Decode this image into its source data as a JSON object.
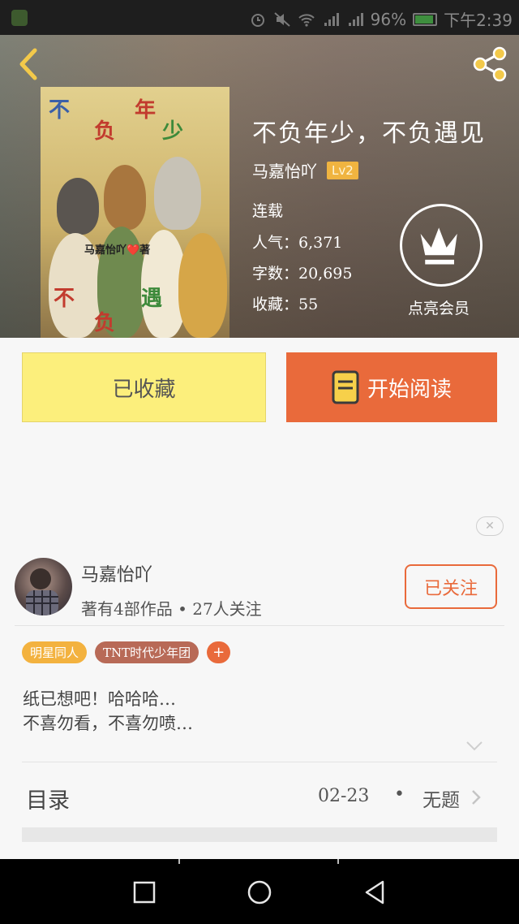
{
  "status_bar": {
    "battery": "96%",
    "time": "下午2:39"
  },
  "header": {
    "back_icon": "chevron-left-icon",
    "share_icon": "share-icon"
  },
  "book": {
    "title": "不负年少，不负遇见",
    "author": "马嘉怡吖",
    "level": "Lv2",
    "status": "连载",
    "popularity": "人气：6,371",
    "word_count": "字数：20,695",
    "favorites": "收藏：55",
    "cover": {
      "chars": [
        "不",
        "负",
        "年",
        "少",
        "不",
        "负",
        "遇"
      ],
      "author_tag": "马嘉怡吖❤️著"
    }
  },
  "vip": {
    "label": "点亮会员",
    "icon": "crown-icon"
  },
  "actions": {
    "favorited_label": "已收藏",
    "read_label": "开始阅读",
    "read_icon": "book-icon"
  },
  "author_card": {
    "name": "马嘉怡吖",
    "stats": "著有4部作品 • 27人关注",
    "follow_label": "已关注"
  },
  "tags": [
    "明星同人",
    "TNT时代少年团"
  ],
  "tag_add": "+",
  "description": {
    "line1": "纸已想吧！哈哈哈…",
    "line2": "不喜勿看，不喜勿喷…"
  },
  "toc": {
    "label": "目录",
    "date": "02-23",
    "separator": "•",
    "latest": "无题"
  },
  "colors": {
    "accent": "#e96a3b",
    "favorite_bg": "#fcef7c",
    "level_badge": "#f0b440"
  }
}
